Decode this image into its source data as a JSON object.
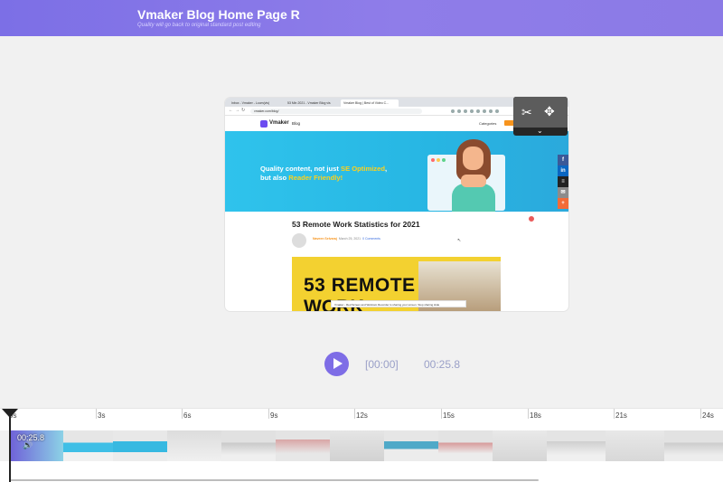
{
  "header": {
    "title": "Vmaker Blog Home Page R",
    "subtitle": "Quality will go back to original standard post editing"
  },
  "preview": {
    "tabs": [
      "Inbox - Vmaker - Loom(vis)",
      "53 Min 2021 - Vmaker Blog vis",
      "Vmaker Blog | Best of Video C..."
    ],
    "url": "vmaker.com/blog/",
    "site_logo": "Vmaker",
    "site_nav_blog": "Blog",
    "site_nav_categories": "Categories",
    "hero_line1_a": "Quality content, not just ",
    "hero_line1_b": "SE Optimized",
    "hero_line1_c": ",",
    "hero_line2_a": "but also ",
    "hero_line2_b": "Reader Friendly!",
    "post_title": "53 Remote Work Statistics for 2021",
    "post_author": "Naveen Selvaraj",
    "post_date": "March 25, 2021",
    "post_comments": "0 Comments",
    "thumb_line1": "53 REMOTE",
    "thumb_line2": "WORK",
    "notification": "Vmaker - Red Screen and Webcam Recorder is sharing your screen.  Stop sharing  Hide",
    "share_icons": [
      "f",
      "in",
      "≡",
      "✉",
      "+"
    ]
  },
  "floater": {
    "icons": [
      "scissors-icon",
      "move-icon",
      "chevron-down-icon"
    ]
  },
  "player": {
    "current_time": "[00:00]",
    "total_time": "00:25.8"
  },
  "timeline": {
    "ticks": [
      "0s",
      "3s",
      "6s",
      "9s",
      "12s",
      "15s",
      "18s",
      "21s",
      "24s"
    ],
    "clip_time": "00:25.8"
  },
  "colors": {
    "header_gradient_start": "#7c6fe6",
    "accent": "#7e6de6",
    "time_text": "#9aa0c8",
    "hero_bg": "#2fc3ec",
    "highlight": "#ffd11a",
    "thumb_bg": "#f3d130"
  }
}
